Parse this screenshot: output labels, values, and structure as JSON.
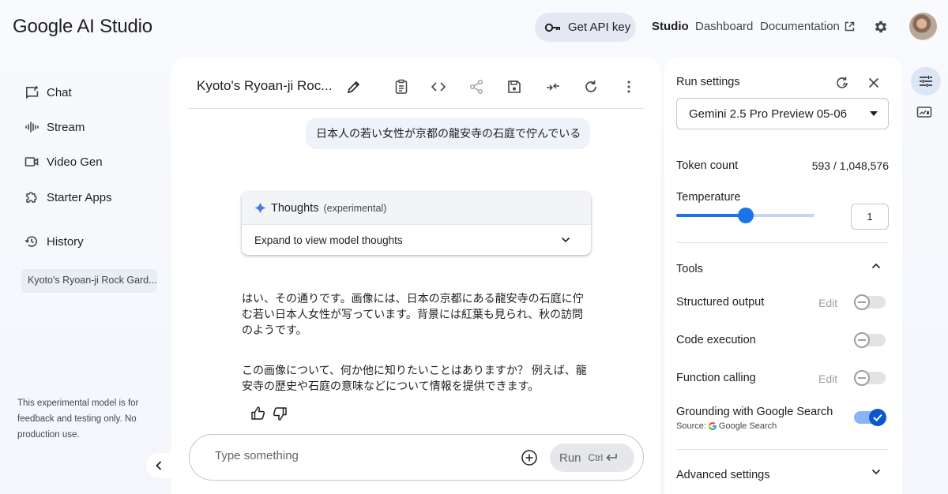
{
  "header": {
    "app_title": "Google AI Studio",
    "api_key_label": "Get API key",
    "nav": {
      "studio": "Studio",
      "dashboard": "Dashboard",
      "documentation": "Documentation"
    }
  },
  "sidebar": {
    "items": [
      {
        "label": "Chat",
        "icon": "chat-icon"
      },
      {
        "label": "Stream",
        "icon": "waveform-icon"
      },
      {
        "label": "Video Gen",
        "icon": "video-icon"
      },
      {
        "label": "Starter Apps",
        "icon": "puzzle-icon"
      },
      {
        "label": "History",
        "icon": "history-icon"
      }
    ],
    "recent_item": "Kyoto's Ryoan-ji Rock Gard...",
    "footer_note": "This experimental model is for feedback and testing only. No production use."
  },
  "main": {
    "prompt_title": "Kyoto's Ryoan-ji Roc...",
    "user_message": "日本人の若い女性が京都の龍安寺の石庭で佇んでいる",
    "thoughts": {
      "title": "Thoughts",
      "tag": "(experimental)",
      "expand_label": "Expand to view model thoughts"
    },
    "response": [
      "はい、その通りです。画像には、日本の京都にある龍安寺の石庭に佇む若い日本人女性が写っています。背景には紅葉も見られ、秋の訪問のようです。",
      "この画像について、何か他に知りたいことはありますか？ 例えば、龍安寺の歴史や石庭の意味などについて情報を提供できます。"
    ],
    "input": {
      "placeholder": "Type something",
      "value": ""
    },
    "run": {
      "label": "Run",
      "shortcut": "Ctrl"
    }
  },
  "settings": {
    "title": "Run settings",
    "model": "Gemini 2.5 Pro Preview 05-06",
    "token_count_label": "Token count",
    "token_count_value": "593 / 1,048,576",
    "temperature_label": "Temperature",
    "temperature_value": "1",
    "temperature_fraction": 0.5,
    "tools_label": "Tools",
    "tools": [
      {
        "label": "Structured output",
        "edit": "Edit",
        "enabled": false
      },
      {
        "label": "Code execution",
        "edit": "",
        "enabled": false
      },
      {
        "label": "Function calling",
        "edit": "Edit",
        "enabled": false
      },
      {
        "label": "Grounding with Google Search",
        "edit": "",
        "enabled": true
      }
    ],
    "grounding_source_prefix": "Source:",
    "grounding_source_name": "Google Search",
    "advanced_label": "Advanced settings"
  },
  "colors": {
    "accent": "#1a73e8",
    "toggle_on": "#0b57d0",
    "panel_bg": "#ffffff",
    "page_bg": "#f8fafd"
  }
}
